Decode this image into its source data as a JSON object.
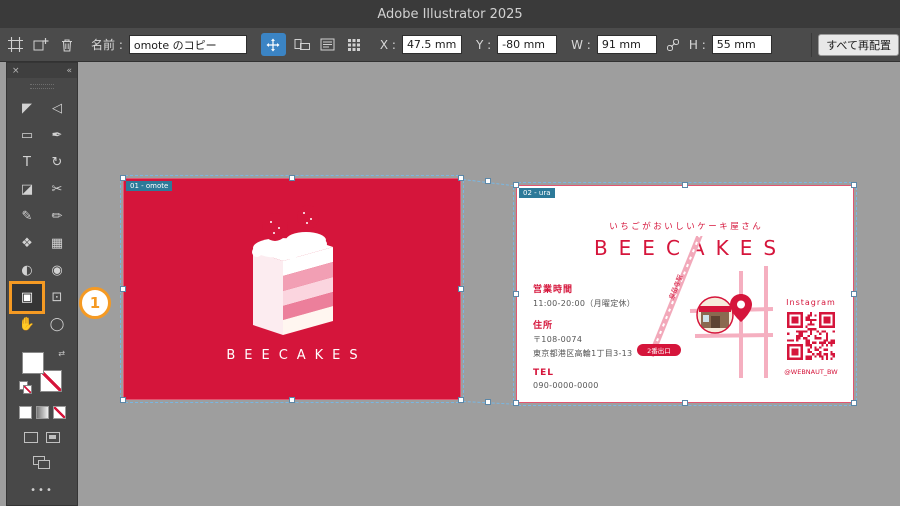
{
  "window": {
    "title": "Adobe Illustrator 2025"
  },
  "control_bar": {
    "name_label": "名前 :",
    "name_value": "omote のコピー",
    "x_label": "X :",
    "x_value": "47.5 mm",
    "y_label": "Y :",
    "y_value": "-80 mm",
    "w_label": "W :",
    "w_value": "91 mm",
    "h_label": "H :",
    "h_value": "55 mm",
    "rearrange_label": "すべて再配置",
    "icons": [
      "artboard-icon",
      "new-artboard-icon",
      "delete-icon",
      "move-artboard-icon",
      "orientation-icon",
      "artboard-options-icon",
      "rearrange-grid-icon",
      "link-dimensions-icon"
    ]
  },
  "tool_panel": {
    "close_glyph": "×",
    "collapse_glyph": "«",
    "swap_glyph": "⇄",
    "ellipsis": "•••",
    "tools": [
      {
        "name": "selection-tool",
        "glyph": "◤"
      },
      {
        "name": "direct-selection-tool",
        "glyph": "◁"
      },
      {
        "name": "rectangle-tool",
        "glyph": "▭"
      },
      {
        "name": "pen-tool",
        "glyph": "✒"
      },
      {
        "name": "type-tool",
        "glyph": "T"
      },
      {
        "name": "rotate-tool",
        "glyph": "↻"
      },
      {
        "name": "eraser-tool",
        "glyph": "◪"
      },
      {
        "name": "scissors-tool",
        "glyph": "✂"
      },
      {
        "name": "paintbrush-tool",
        "glyph": "✎"
      },
      {
        "name": "pencil-tool",
        "glyph": "✏"
      },
      {
        "name": "shaper-tool",
        "glyph": "❖"
      },
      {
        "name": "gradient-tool",
        "glyph": "▦"
      },
      {
        "name": "eyedropper-tool",
        "glyph": "◐"
      },
      {
        "name": "blend-tool",
        "glyph": "◉"
      },
      {
        "name": "artboard-tool",
        "glyph": "▣",
        "highlighted": true
      },
      {
        "name": "slice-tool",
        "glyph": "⊡"
      },
      {
        "name": "hand-tool",
        "glyph": "✋"
      },
      {
        "name": "zoom-tool",
        "glyph": "◯"
      }
    ]
  },
  "annotation": {
    "step_number": "1"
  },
  "artboards": {
    "omote": {
      "tab": "01 - omote",
      "brand": "BEECAKES"
    },
    "ura": {
      "tab": "02 - ura",
      "tagline": "いちごがおいしいケーキ屋さん",
      "brand": "BEECAKES",
      "hours_label": "営業時間",
      "hours_value": "11:00-20:00（月曜定休）",
      "address_label": "住所",
      "postal_code": "〒108-0074",
      "address_value": "東京都港区高輪1丁目3-13",
      "tel_label": "TEL",
      "tel_value": "090-0000-0000",
      "instagram_label": "Instagram",
      "instagram_handle": "@WEBNAUT_BW",
      "map": {
        "exit_badge": "2番出口",
        "station_label": "泉岳寺駅"
      }
    }
  },
  "colors": {
    "brand_red": "#d5153b",
    "accent_orange": "#f59a23",
    "tab_teal": "#2d7a99",
    "selection_blue": "#79b7e3"
  }
}
